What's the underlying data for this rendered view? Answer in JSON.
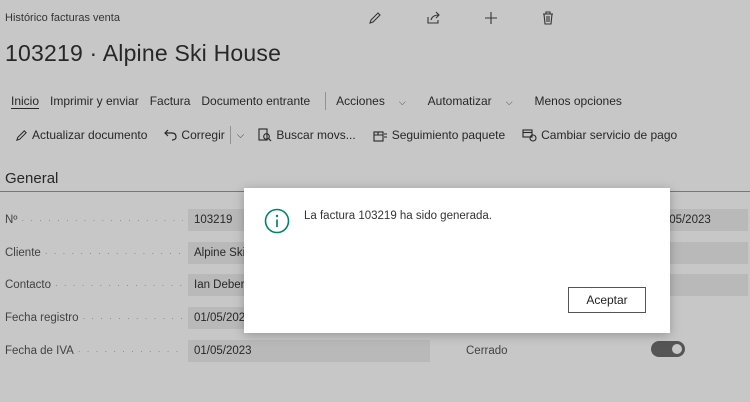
{
  "breadcrumb": "Histórico facturas venta",
  "header_icons": [
    "pencil-icon",
    "share-icon",
    "plus-icon",
    "trash-icon"
  ],
  "title": "103219 · Alpine Ski House",
  "action_menu": [
    {
      "label": "Inicio",
      "active": true
    },
    {
      "label": "Imprimir y enviar"
    },
    {
      "label": "Factura"
    },
    {
      "label": "Documento entrante"
    },
    {
      "label": "Acciones",
      "dropdown": true
    },
    {
      "label": "Automatizar",
      "dropdown": true
    },
    {
      "label": "Menos opciones"
    }
  ],
  "toolbar": {
    "update_document": "Actualizar documento",
    "correct": "Corregir",
    "find_entries": "Buscar movs...",
    "package_tracking": "Seguimiento paquete",
    "change_payment": "Cambiar servicio de pago"
  },
  "section": {
    "title": "General"
  },
  "fields": [
    {
      "label": "Nº",
      "value": "103219"
    },
    {
      "label": "Cliente",
      "value": "Alpine Ski"
    },
    {
      "label": "Contacto",
      "value": "Ian Deber"
    },
    {
      "label": "Fecha registro",
      "value": "01/05/202"
    },
    {
      "label": "Fecha de IVA",
      "value": "01/05/2023"
    }
  ],
  "right_fields": {
    "top_date": "/05/2023",
    "closed_label": "Cerrado",
    "closed_on": true
  },
  "dialog": {
    "message": "La factura 103219 ha sido generada.",
    "ok_label": "Aceptar"
  },
  "colors": {
    "overlay": "#0000003a",
    "accent_teal": "#00836d",
    "toggle": "#6d6d6d"
  }
}
